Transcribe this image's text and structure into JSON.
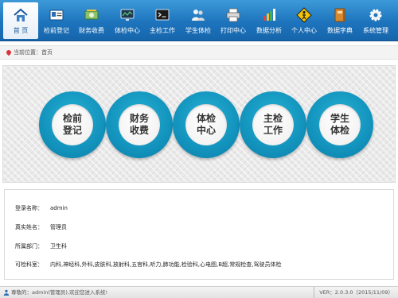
{
  "nav": {
    "items": [
      {
        "label": "首 页",
        "icon": "home-icon"
      },
      {
        "label": "检前登记",
        "icon": "id-card-icon"
      },
      {
        "label": "财务收费",
        "icon": "money-icon"
      },
      {
        "label": "体检中心",
        "icon": "monitor-icon"
      },
      {
        "label": "主检工作",
        "icon": "terminal-icon"
      },
      {
        "label": "学生体检",
        "icon": "students-icon"
      },
      {
        "label": "打印中心",
        "icon": "printer-icon"
      },
      {
        "label": "数据分析",
        "icon": "bar-chart-icon"
      },
      {
        "label": "个人中心",
        "icon": "person-sign-icon"
      },
      {
        "label": "数据字典",
        "icon": "dictionary-icon"
      },
      {
        "label": "系统管理",
        "icon": "gear-icon"
      }
    ],
    "active_index": 0
  },
  "breadcrumb": {
    "text": "当前位置：首页"
  },
  "modules": [
    {
      "label": "检前登记"
    },
    {
      "label": "财务收费"
    },
    {
      "label": "体检中心"
    },
    {
      "label": "主检工作"
    },
    {
      "label": "学生体检"
    }
  ],
  "info": {
    "login_label": "登录名称：",
    "login_value": "admin",
    "realname_label": "真实姓名：",
    "realname_value": "管理员",
    "dept_label": "所属部门：",
    "dept_value": "卫生科",
    "depts_label": "可检科室：",
    "depts_value": "内科,神经科,外科,皮肤科,放射科,五官科,听力,肺功能,检验科,心电图,B超,常规检查,驾驶员体检"
  },
  "status": {
    "welcome": "尊敬的：admin(管理员),欢迎您进入系统!",
    "version": "VER：2.0.3.0（2015/11/09）"
  },
  "colors": {
    "nav_bg": "#1d74bd",
    "module_ring": "#1293bd",
    "breadcrumb_pin": "#d9343a"
  }
}
